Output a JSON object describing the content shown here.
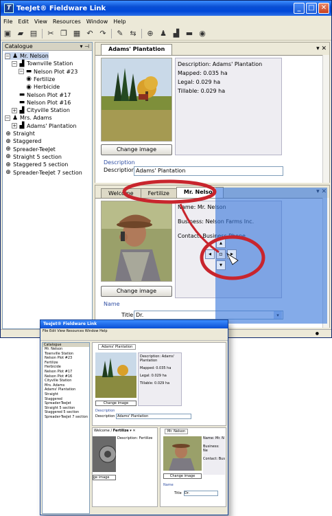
{
  "window": {
    "title": "TeeJet® Fieldware Link",
    "app_icon_glyph": "T"
  },
  "menu": [
    "File",
    "Edit",
    "View",
    "Resources",
    "Window",
    "Help"
  ],
  "catalogue": {
    "title": "Catalogue",
    "tree": [
      {
        "label": "Mr. Nelson",
        "icon": "person-icon",
        "level": 0,
        "expander": "−",
        "selected": true
      },
      {
        "label": "Townville Station",
        "icon": "station-icon",
        "level": 1,
        "expander": "−"
      },
      {
        "label": "Nelson Plot #23",
        "icon": "field-icon",
        "level": 2,
        "expander": "−"
      },
      {
        "label": "Fertilize",
        "icon": "job-icon",
        "level": 3,
        "expander": ""
      },
      {
        "label": "Herbicide",
        "icon": "job-icon",
        "level": 3,
        "expander": ""
      },
      {
        "label": "Nelson Plot #17",
        "icon": "field-icon",
        "level": 2,
        "expander": ""
      },
      {
        "label": "Nelson Plot #16",
        "icon": "field-icon",
        "level": 2,
        "expander": ""
      },
      {
        "label": "Cityville Station",
        "icon": "station-icon",
        "level": 1,
        "expander": "+"
      },
      {
        "label": "Mrs. Adams",
        "icon": "person-icon",
        "level": 0,
        "expander": "−"
      },
      {
        "label": "Adams' Plantation",
        "icon": "station-icon",
        "level": 1,
        "expander": "+"
      },
      {
        "label": "Straight",
        "icon": "nozzle-icon",
        "level": 0,
        "expander": ""
      },
      {
        "label": "Staggered",
        "icon": "nozzle-icon",
        "level": 0,
        "expander": ""
      },
      {
        "label": "Spreader-TeeJet",
        "icon": "nozzle-icon",
        "level": 0,
        "expander": ""
      },
      {
        "label": "Straight 5 section",
        "icon": "nozzle-icon",
        "level": 0,
        "expander": ""
      },
      {
        "label": "Staggered 5 section",
        "icon": "nozzle-icon",
        "level": 0,
        "expander": ""
      },
      {
        "label": "Spreader-TeeJet 7 section",
        "icon": "nozzle-icon",
        "level": 0,
        "expander": ""
      }
    ]
  },
  "top_panel": {
    "tabs": [
      "Adams' Plantation"
    ],
    "info": {
      "description": "Description: Adams' Plantation",
      "mapped": "Mapped: 0.035 ha",
      "legal": "Legal: 0.029 ha",
      "tillable": "Tillable: 0.029 ha"
    },
    "change_image": "Change image",
    "section_title": "Description",
    "field_label": "Description",
    "field_value": "Adams' Plantation"
  },
  "bottom_panel": {
    "tabs": [
      "Welcome",
      "Fertilize",
      "Mr. Nelson"
    ],
    "info": {
      "name": "Name: Mr. Nelson",
      "business": "Business: Nelson Farms Inc.",
      "contact": "Contact: Business Phone"
    },
    "change_image": "Change image",
    "section_title": "Name",
    "field_label": "Title",
    "field_value": "Dr."
  },
  "thumbnail": {
    "title": "TeeJet® Fieldware Link",
    "menu": "File  Edit  View  Resources  Window  Help",
    "catalogue_title": "Catalogue",
    "top_tab": "Adams' Plantation",
    "left_tabs": [
      "Welcome",
      "Fertilize"
    ],
    "right_tab": "Mr. Nelson",
    "left_info": "Description: Fertilize",
    "right_info": [
      "Name: Mr. N",
      "Business: Ne",
      "Contact: Bus"
    ],
    "change_image": "Change image",
    "left_change_image": "ge image",
    "name_section": "Name",
    "title_label": "Title",
    "title_value": "Dr.",
    "top_info": [
      "Description: Adams' Plantation",
      "Mapped: 0.035 ha",
      "Legal: 0.029 ha",
      "Tillable: 0.029 ha"
    ],
    "desc_section": "Description",
    "desc_label": "Description",
    "desc_value": "Adams' Plantation",
    "tree": [
      "Mr. Nelson",
      "Townville Station",
      "Nelson Plot #23",
      "Fertilize",
      "Herbicide",
      "Nelson Plot #17",
      "Nelson Plot #16",
      "Cityville Station",
      "Mrs. Adams",
      "Adams' Plantation",
      "Straight",
      "Staggered",
      "Spreader-TeeJet",
      "Straight 5 section",
      "Staggered 5 section",
      "Spreader-TeeJet 7 section"
    ]
  },
  "colors": {
    "titlebar": "#0a4fd4",
    "dock_overlay": "#3878dc",
    "highlight_circle": "#c8252d"
  }
}
